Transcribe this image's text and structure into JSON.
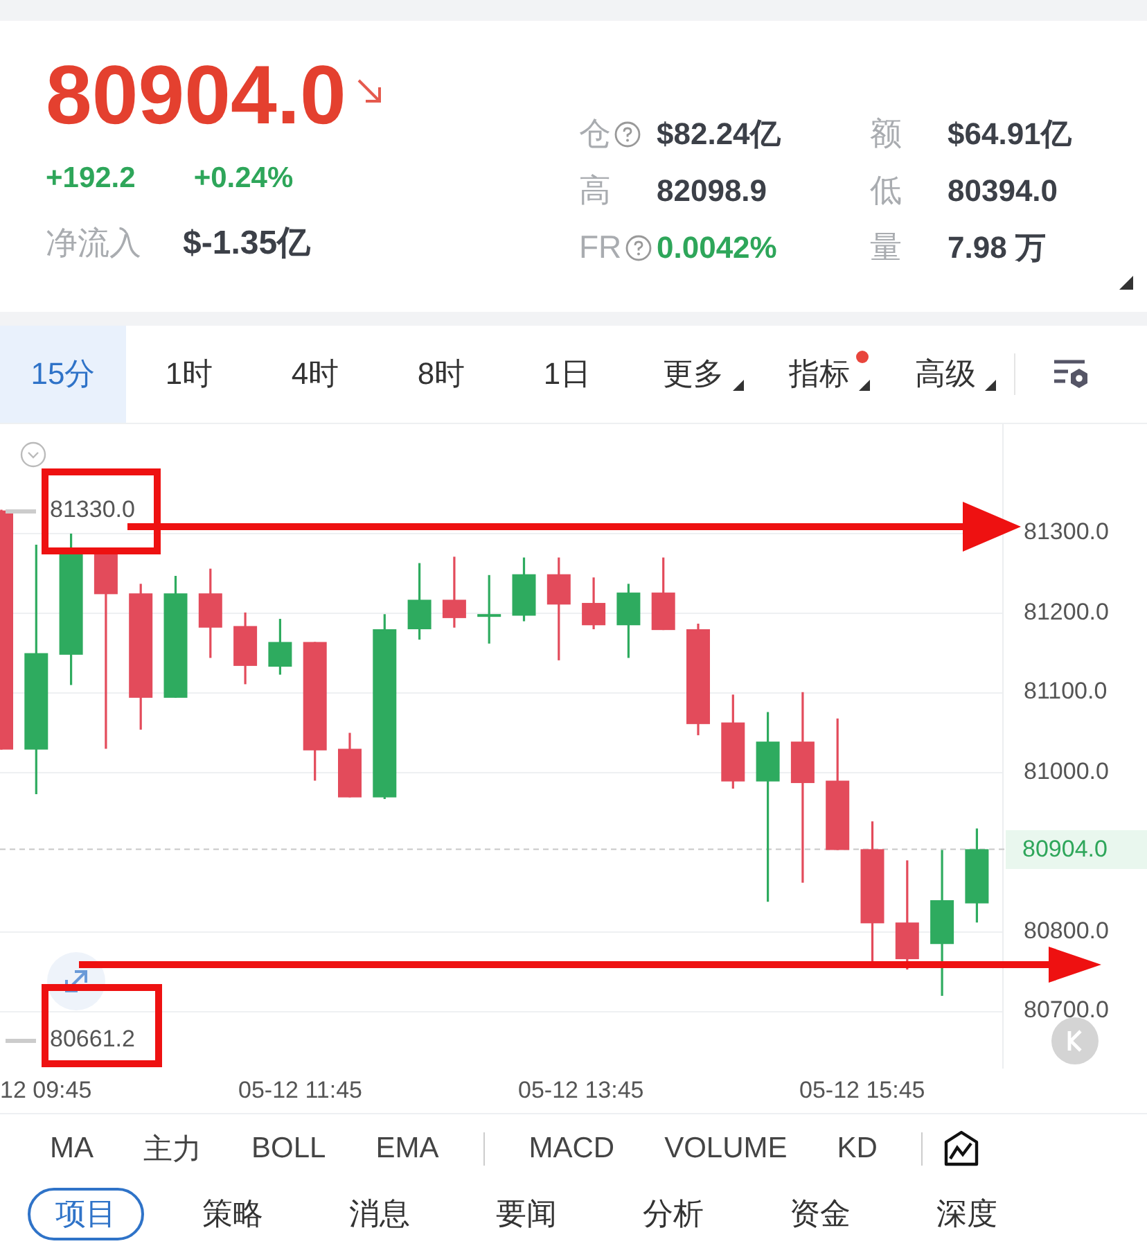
{
  "quote": {
    "price": "80904.0",
    "change": "+192.2",
    "change_pct": "+0.24%",
    "net_inflow_label": "净流入",
    "net_inflow": "$-1.35亿"
  },
  "stats": [
    {
      "label": "仓",
      "help": true,
      "value": "$82.24亿",
      "highlight": false
    },
    {
      "label": "额",
      "help": false,
      "value": "$64.91亿",
      "highlight": false
    },
    {
      "label": "高",
      "help": false,
      "value": "82098.9",
      "highlight": false
    },
    {
      "label": "低",
      "help": false,
      "value": "80394.0",
      "highlight": false
    },
    {
      "label": "FR",
      "help": true,
      "value": "0.0042%",
      "highlight": true
    },
    {
      "label": "量",
      "help": false,
      "value": "7.98 万",
      "highlight": false
    }
  ],
  "timeframe_tabs": [
    {
      "label": "15分",
      "selected": true,
      "dropdown": false,
      "dot": false
    },
    {
      "label": "1时",
      "selected": false,
      "dropdown": false,
      "dot": false
    },
    {
      "label": "4时",
      "selected": false,
      "dropdown": false,
      "dot": false
    },
    {
      "label": "8时",
      "selected": false,
      "dropdown": false,
      "dot": false
    },
    {
      "label": "1日",
      "selected": false,
      "dropdown": false,
      "dot": false
    },
    {
      "label": "更多",
      "selected": false,
      "dropdown": true,
      "dot": false
    },
    {
      "label": "指标",
      "selected": false,
      "dropdown": true,
      "dot": true
    },
    {
      "label": "高级",
      "selected": false,
      "dropdown": true,
      "dot": false
    }
  ],
  "chart": {
    "max_label": "81330.0",
    "min_label": "80661.2",
    "current_price": "80904.0",
    "annotated": true,
    "price_axis": [
      "81300.0",
      "81200.0",
      "81100.0",
      "81000.0",
      "80800.0",
      "80700.0"
    ],
    "time_axis": [
      "12 09:45",
      "05-12 11:45",
      "05-12 13:45",
      "05-12 15:45"
    ]
  },
  "indicators": [
    {
      "label": "MA",
      "kind": "item"
    },
    {
      "label": "主力",
      "kind": "item"
    },
    {
      "label": "BOLL",
      "kind": "item"
    },
    {
      "label": "EMA",
      "kind": "item"
    },
    {
      "kind": "divider"
    },
    {
      "label": "MACD",
      "kind": "item"
    },
    {
      "label": "VOLUME",
      "kind": "item"
    },
    {
      "label": "KD",
      "kind": "item"
    }
  ],
  "section_tabs": [
    {
      "label": "项目",
      "selected": true
    },
    {
      "label": "策略",
      "selected": false
    },
    {
      "label": "消息",
      "selected": false
    },
    {
      "label": "要闻",
      "selected": false
    },
    {
      "label": "分析",
      "selected": false
    },
    {
      "label": "资金",
      "selected": false
    },
    {
      "label": "深度",
      "selected": false
    }
  ]
}
